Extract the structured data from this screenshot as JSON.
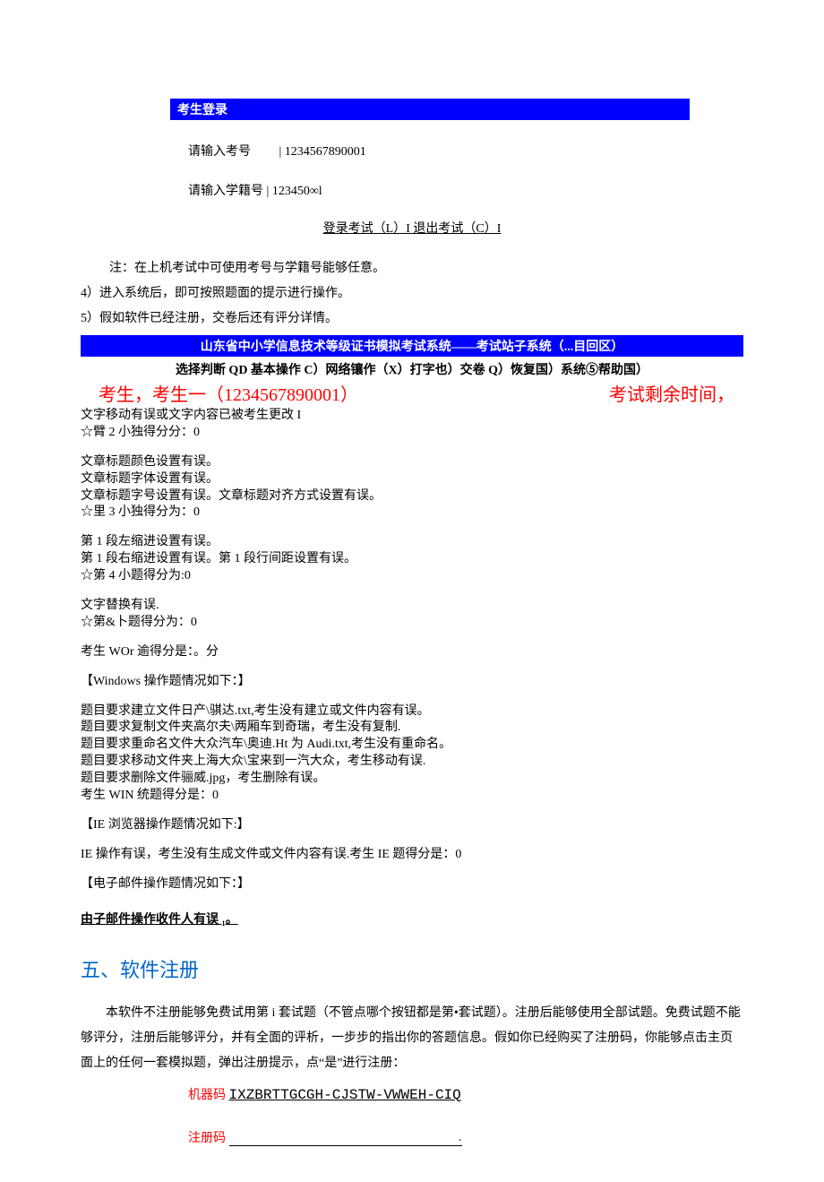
{
  "login_header": "考生登录",
  "login_exam_label": "请输入考号",
  "login_exam_value": "| 1234567890001",
  "login_student_label": "请输入学籍号 | ",
  "login_student_value": "123450∞l",
  "login_buttons": "登录考试（L）I 退出考试（C）I",
  "note": "注：在上机考试中可使用考号与学籍号能够任意。",
  "step4": "4）进入系统后，即可按照题面的提示进行操作。",
  "step5": "5）假如软件已经注册，交卷后还有评分详情。",
  "system_title": "山东省中小学信息技术等级证书模拟考试系统——考试站子系统（...目回区）",
  "menu_line": "选择判断 QD 基本操作 C）网络镶作（X）打字也）交卷 Q）恢复国）系统⑤帮助国）",
  "student_name": "考生，考生一（1234567890001）",
  "timer_label": "考试剩余时间，",
  "body": {
    "l1": "文字移动有误或文字内容已被考生更改 I",
    "l2": "☆臂 2 小独得分分：0",
    "l3": "文章标题颜色设置有误。",
    "l4": "文章标题字体设置有误。",
    "l5": "文章标题字号设置有误。文章标题对齐方式设置有误。",
    "l6": "☆里 3 小独得分为：0",
    "l7": "第 1 段左缩进设置有误。",
    "l8": "第 1 段右缩进设置有误。第 1 段行间距设置有误。",
    "l9": "☆第 4 小题得分为:0",
    "l10": "文字替换有误.",
    "l11": "☆第&卜题得分为：0",
    "l12": "考生 WOr 逾得分是：。分",
    "l13": "【Windows 操作题情况如下：】",
    "l14": "题目要求建立文件日产\\骐达.txt,考生没有建立或文件内容有误。",
    "l15": "题目要求复制文件夹高尔夫\\两厢车到奇瑞，考生没有复制.",
    "l16": "题目要求重命名文件大众汽车\\奥迪.Ht 为 Audi.txt,考生没有重命名。",
    "l17": "题目要求移动文件夹上海大众\\宝来到一汽大众，考生移动有误.",
    "l18": "题目要求删除文件骊威.jpg，考生删除有误。",
    "l19": "考生 WIN 统题得分是：0",
    "l20": "【IE 浏览器操作题情况如下:】",
    "l21": "IE 操作有误，考生没有生成文件或文件内容有误.考生 IE 题得分是：0",
    "l22": "【电子邮件操作题情况如下：】",
    "l23": "由子邮件操作收件人有误 ₁。"
  },
  "section5_title": "五、软件注册",
  "section5_para": "本软件不注册能够免费试用第 i 套试题（不管点哪个按钮都是第•套试题）。注册后能够使用全部试题。免费试题不能够评分，注册后能够评分，并有全面的评析，一步步的指出你的答题信息。假如你已经购买了注册码，你能够点击主页面上的任何一套模拟题，弹出注册提示，点“是”进行注册：",
  "machine_code_label": "机器码 ",
  "machine_code_value": "IXZBRTTGCGH-CJSTW-VWWEH-CIQ",
  "reg_code_label": "注册码",
  "reg_code_dot": "."
}
